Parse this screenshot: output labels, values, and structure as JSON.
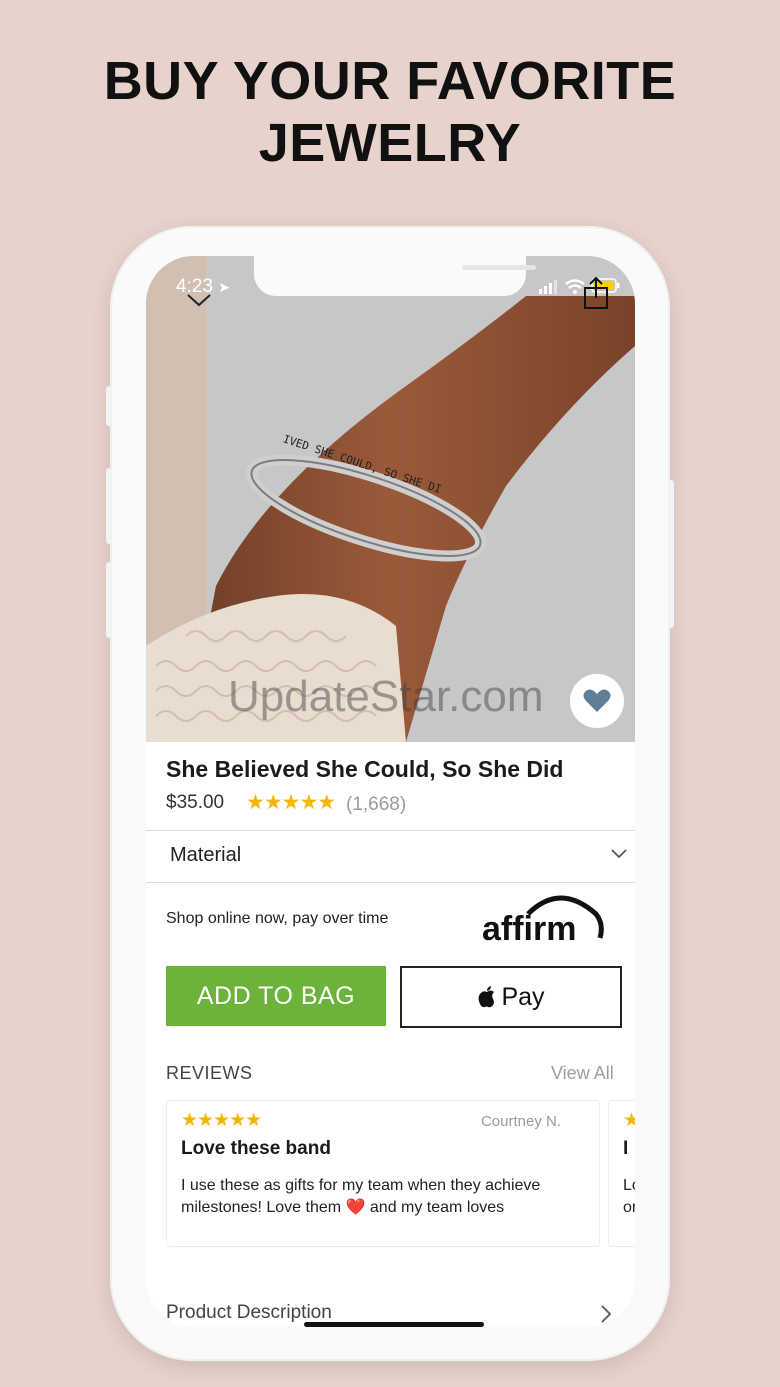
{
  "headline": {
    "line1": "BUY YOUR FAVORITE",
    "line2": "JEWELRY"
  },
  "status_bar": {
    "time": "4:23",
    "battery_color": "#f7d200"
  },
  "watermark": "UpdateStar.com",
  "product": {
    "title": "She Believed She Could, So She Did",
    "price": "$35.00",
    "stars": "★★★★★",
    "rating_count": "(1,668)",
    "engraving": "IVED SHE COULD, SO SHE DI"
  },
  "material": {
    "label": "Material"
  },
  "financing": {
    "text": "Shop online now, pay over time",
    "brand": "affirm"
  },
  "buttons": {
    "add_to_bag": "ADD TO BAG",
    "apple_pay": "Pay",
    "add_to_bag_color": "#6bb33a"
  },
  "reviews": {
    "heading": "REVIEWS",
    "view_all": "View All",
    "items": [
      {
        "stars": "★★★★★",
        "author": "Courtney N.",
        "title": "Love these band",
        "body": "I use these as gifts for my team when they achieve milestones! Love them ❤️ and my team loves"
      },
      {
        "stars": "★",
        "title": "I",
        "body": "Lo or"
      }
    ]
  },
  "product_description": {
    "label": "Product Description"
  }
}
